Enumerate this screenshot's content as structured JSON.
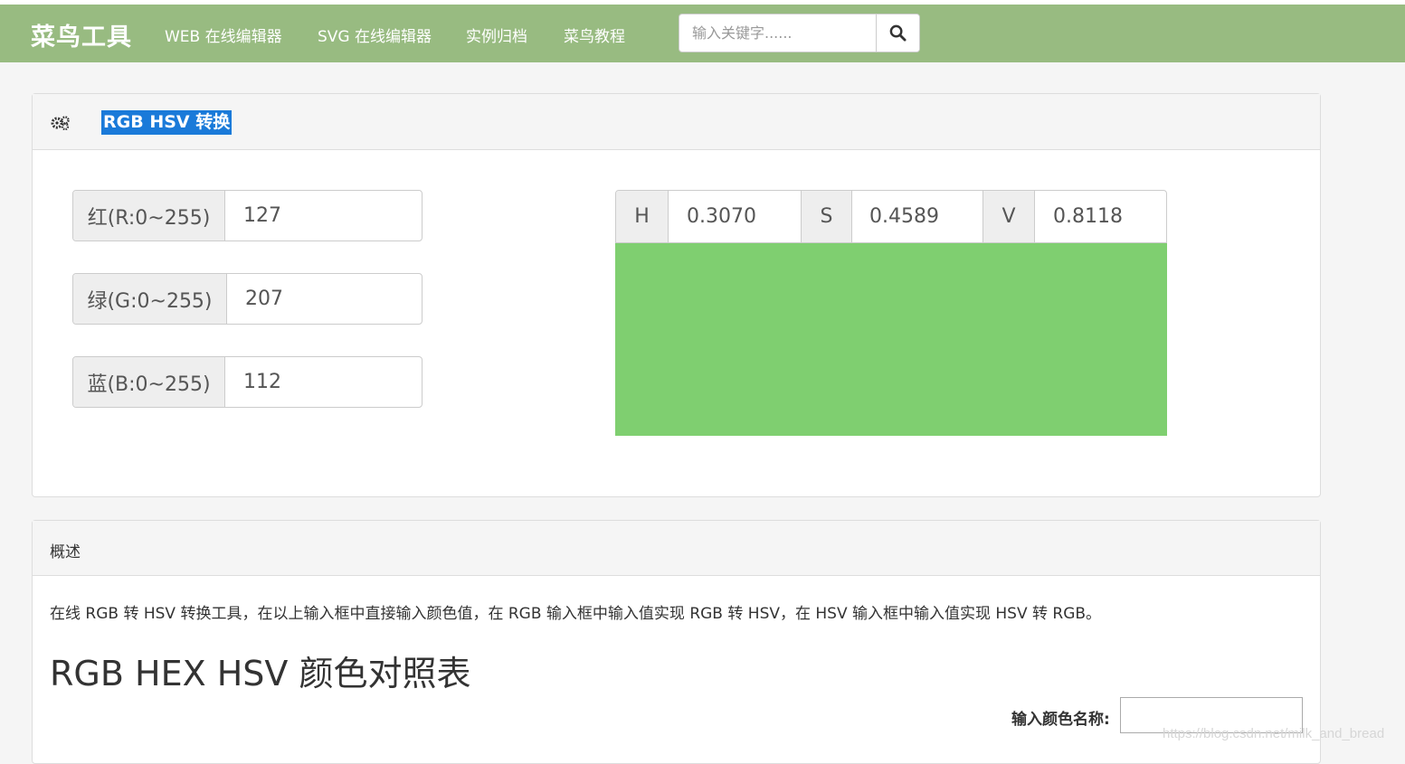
{
  "navbar": {
    "brand": "菜鸟工具",
    "links": [
      "WEB 在线编辑器",
      "SVG 在线编辑器",
      "实例归档",
      "菜鸟教程"
    ],
    "search": {
      "placeholder": "输入关键字......"
    }
  },
  "converter": {
    "title": "RGB HSV 转换",
    "rgb": [
      {
        "label": "红(R:0~255)",
        "value": "127"
      },
      {
        "label": "绿(G:0~255)",
        "value": "207"
      },
      {
        "label": "蓝(B:0~255)",
        "value": "112"
      }
    ],
    "hsv": [
      {
        "label": "H",
        "value": "0.3070"
      },
      {
        "label": "S",
        "value": "0.4589"
      },
      {
        "label": "V",
        "value": "0.8118"
      }
    ],
    "swatch_color": "#7fcf70"
  },
  "overview": {
    "title": "概述",
    "description": "在线 RGB 转 HSV 转换工具，在以上输入框中直接输入颜色值，在 RGB 输入框中输入值实现 RGB 转 HSV，在 HSV 输入框中输入值实现 HSV 转 RGB。",
    "table_heading": "RGB HEX HSV 颜色对照表",
    "color_name_label": "输入颜色名称:"
  },
  "watermark": "https://blog.csdn.net/milk_and_bread",
  "colors": {
    "navbar": "#98bb81",
    "title_highlight": "#1a7ad9"
  }
}
